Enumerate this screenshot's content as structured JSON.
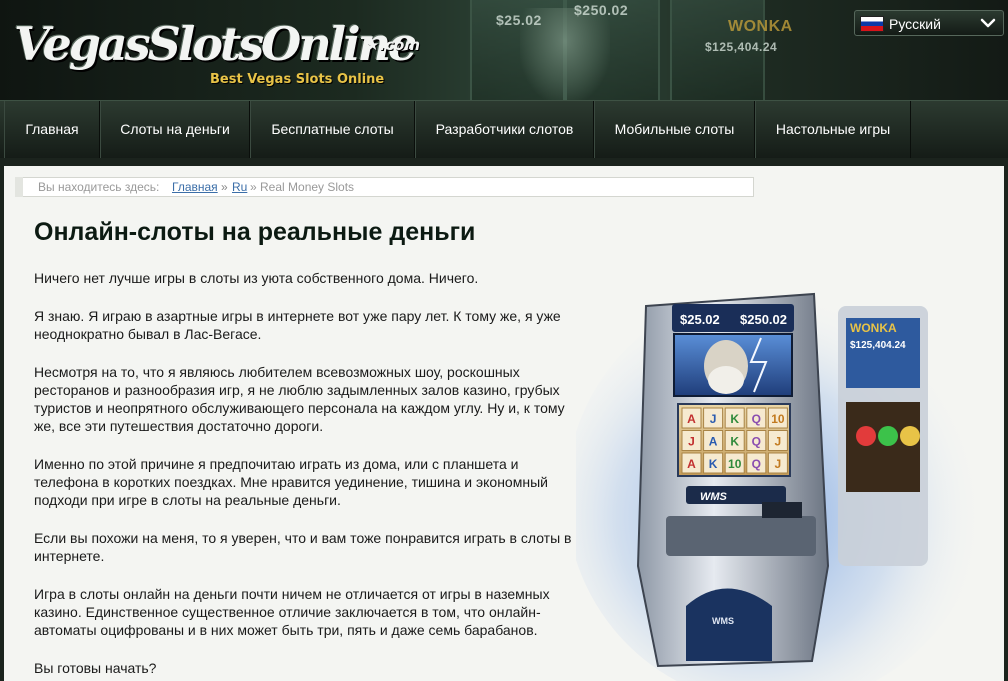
{
  "header": {
    "logo_main": "VegasSlotsOnline",
    "logo_suffix": "★.com",
    "logo_tagline": "Best Vegas Slots Online",
    "bg_amounts": [
      "$25.02",
      "$250.02",
      "$125,404.24"
    ],
    "bg_wonka": "WONKA"
  },
  "language": {
    "label": "Русский",
    "flag_icon": "russian-flag-icon"
  },
  "nav": {
    "items": [
      {
        "label": "Главная"
      },
      {
        "label": "Слоты на деньги"
      },
      {
        "label": "Бесплатные слоты"
      },
      {
        "label": "Разработчики слотов"
      },
      {
        "label": "Мобильные слоты"
      },
      {
        "label": "Настольные игры"
      }
    ]
  },
  "breadcrumb": {
    "lead": "Вы находитесь здесь:",
    "home": "Главная",
    "sep": "»",
    "ru": "Ru",
    "current": "» Real Money Slots"
  },
  "main": {
    "title": "Онлайн-слоты на реальные деньги",
    "paragraphs": [
      "Ничего нет лучше игры в слоты из уюта собственного дома. Ничего.",
      "Я знаю. Я играю в азартные игры в интернете вот уже пару лет. К тому же, я уже неоднократно бывал в Лас-Вегасе.",
      "Несмотря на то, что я являюсь любителем всевозможных шоу, роскошных ресторанов и разнообразия игр, я не люблю задымленных залов казино, грубых туристов и неопрятного обслуживающего персонала на каждом углу. Ну и, к тому же, все эти путешествия достаточно дороги.",
      "Именно по этой причине я предпочитаю играть из дома, или с планшета и телефона в коротких поездках. Мне нравится уединение, тишина и экономный подходи при игре в слоты на реальные деньги.",
      "Если вы похожи на меня, то я уверен, что и вам тоже понравится играть в слоты в интернете.",
      "Игра в слоты онлайн на деньги почти ничем не отличается от игры в наземных казино. Единственное существенное отличие заключается в том, что онлайн-автоматы оцифрованы и в них может быть три, пять и даже семь барабанов.",
      "Вы готовы начать?"
    ]
  },
  "slot_art": {
    "amount_left": "$25.02",
    "amount_right": "$250.02",
    "side_amount": "$125,404.24",
    "side_brand": "WONKA",
    "brand": "WMS",
    "reel_symbols": [
      "A",
      "J",
      "K",
      "Q",
      "10",
      "J",
      "A",
      "K",
      "Q",
      "J",
      "A",
      "K",
      "10",
      "Q",
      "J"
    ]
  },
  "colors": {
    "header_bg": "#1c2a20",
    "content_bg": "#f4f5f2",
    "link": "#3b6ea8",
    "tagline": "#e8c347",
    "title": "#0c1a12"
  }
}
